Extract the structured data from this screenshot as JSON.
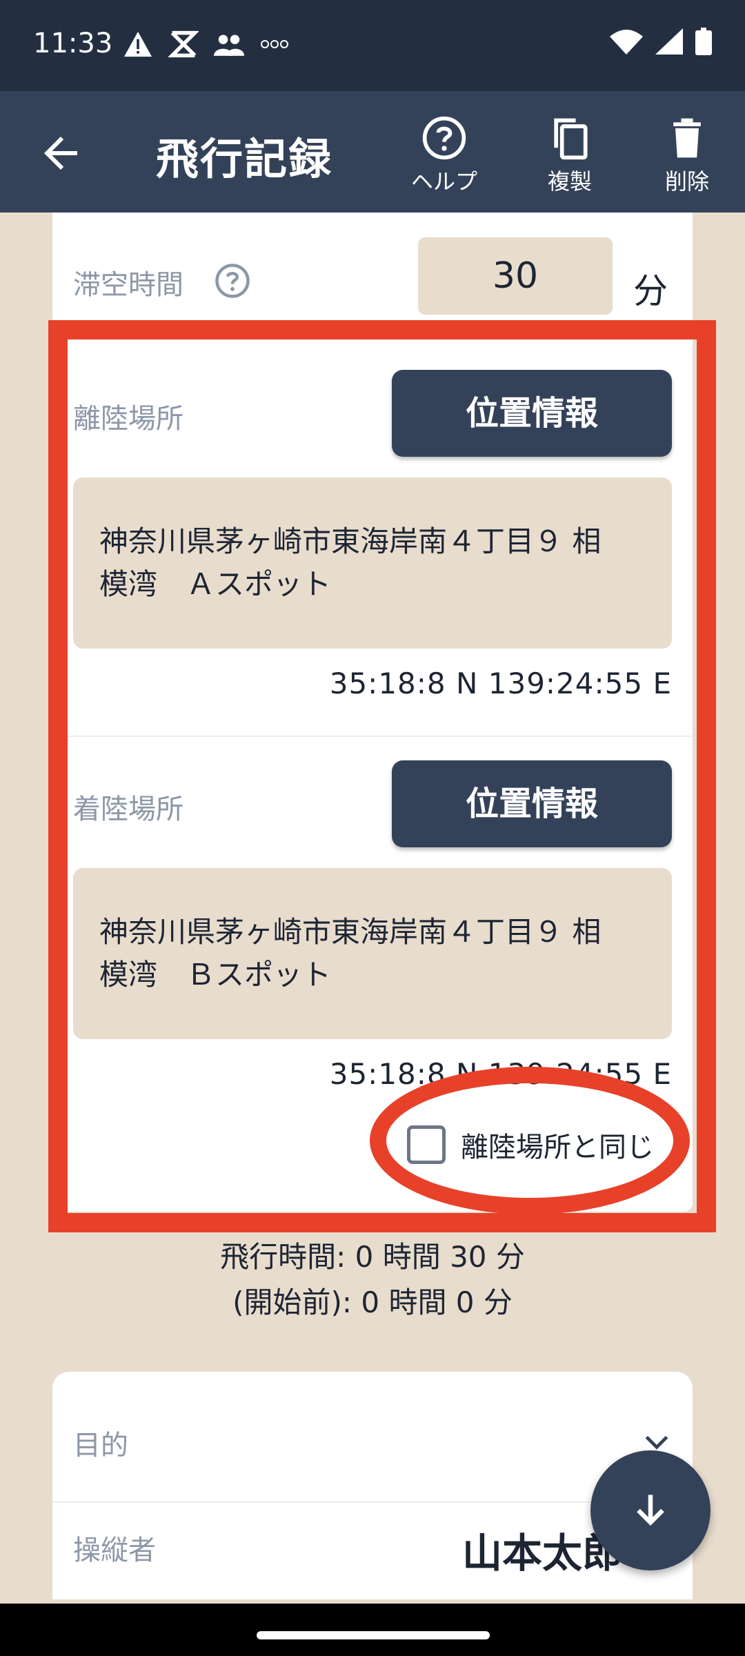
{
  "status": {
    "time": "11:33",
    "icons": [
      "warning-icon",
      "sim-icon",
      "people-icon",
      "app-logo-icon",
      "wifi-icon",
      "signal-icon",
      "battery-icon"
    ]
  },
  "appbar": {
    "title": "飛行記録",
    "help_label": "ヘルプ",
    "copy_label": "複製",
    "delete_label": "削除"
  },
  "flight": {
    "duration_label": "滞空時間",
    "duration_value": "30",
    "duration_unit": "分"
  },
  "takeoff": {
    "label": "離陸場所",
    "button": "位置情報",
    "address_line1": "神奈川県茅ヶ崎市東海岸南４丁目９ 相",
    "address_line2": "模湾　Ａスポット",
    "coords": "35:18:8 N 139:24:55 E"
  },
  "landing": {
    "label": "着陸場所",
    "button": "位置情報",
    "address_line1": "神奈川県茅ヶ崎市東海岸南４丁目９ 相",
    "address_line2": "模湾　Ｂスポット",
    "coords": "35:18:8 N 139:24:55 E",
    "same_label": "離陸場所と同じ",
    "same_checked": false
  },
  "summary": {
    "line1": "飛行時間: 0 時間 30 分",
    "line2": "(開始前): 0 時間 0 分"
  },
  "details": {
    "purpose_label": "目的",
    "operator_label": "操縦者",
    "operator_value": "山本太郎"
  },
  "colors": {
    "header": "#344259",
    "statusbar": "#232f41",
    "background": "#e8dccd",
    "highlight": "#e8412a"
  }
}
